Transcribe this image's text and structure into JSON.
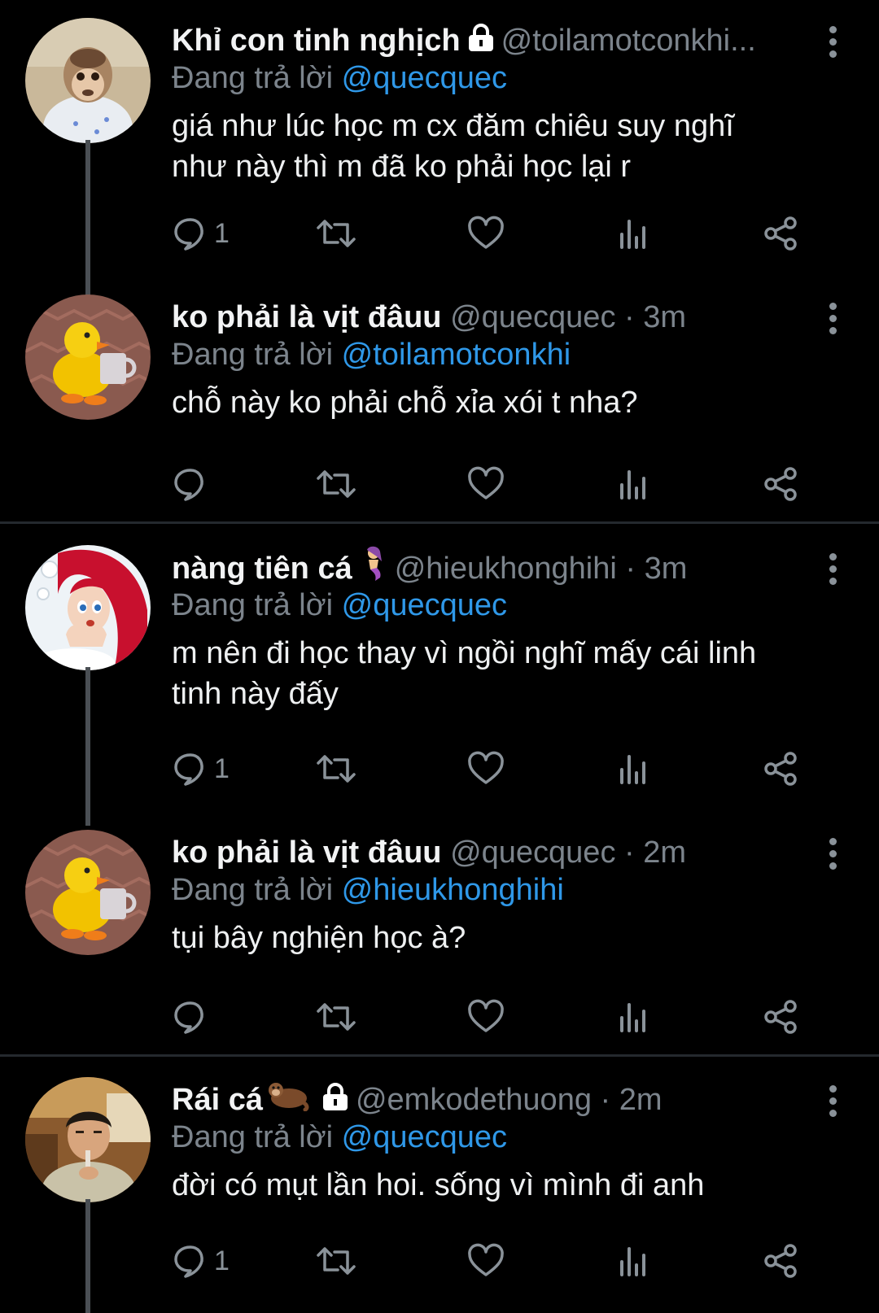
{
  "tweets": [
    {
      "name": "Khỉ con tinh nghịch",
      "handle": "@toilamotconkhi...",
      "time": "",
      "reply_prefix": "Đang trả lời",
      "reply_to": "@quecquec",
      "text": "giá như lúc học m cx đăm chiêu suy nghĩ\nnhư này thì m đã ko phải học lại r",
      "reply_count": "1",
      "avatar_icon": "monkey-avatar",
      "badges": [
        "lock-icon"
      ]
    },
    {
      "name": "ko phải là vịt đâuu",
      "handle": "@quecquec",
      "time": "· 3m",
      "reply_prefix": "Đang trả lời",
      "reply_to": "@toilamotconkhi",
      "text": "chỗ này ko phải chỗ xỉa xói t nha?",
      "reply_count": "",
      "avatar_icon": "duck-avatar",
      "badges": []
    },
    {
      "name": "nàng tiên cá",
      "handle": "@hieukhonghihi",
      "time": "· 3m",
      "reply_prefix": "Đang trả lời",
      "reply_to": "@quecquec",
      "text": "m nên đi học thay vì ngồi nghĩ mấy cái linh\ntinh này đấy",
      "reply_count": "1",
      "avatar_icon": "mermaid-avatar",
      "badges": [
        "mermaid-emoji"
      ]
    },
    {
      "name": "ko phải là vịt đâuu",
      "handle": "@quecquec",
      "time": "· 2m",
      "reply_prefix": "Đang trả lời",
      "reply_to": "@hieukhonghihi",
      "text": "tụi bây nghiện học à?",
      "reply_count": "",
      "avatar_icon": "duck-avatar",
      "badges": []
    },
    {
      "name": "Rái cá",
      "handle": "@emkodethuong",
      "time": "· 2m",
      "reply_prefix": "Đang trả lời",
      "reply_to": "@quecquec",
      "text": "đời có mụt lần hoi. sống vì mình đi anh",
      "reply_count": "1",
      "avatar_icon": "person-avatar",
      "badges": [
        "otter-emoji",
        "lock-icon"
      ]
    }
  ],
  "colors": {
    "background": "#000000",
    "mention": "#2f98e8",
    "muted": "#7c848c",
    "thread_line": "#4a4f54"
  }
}
